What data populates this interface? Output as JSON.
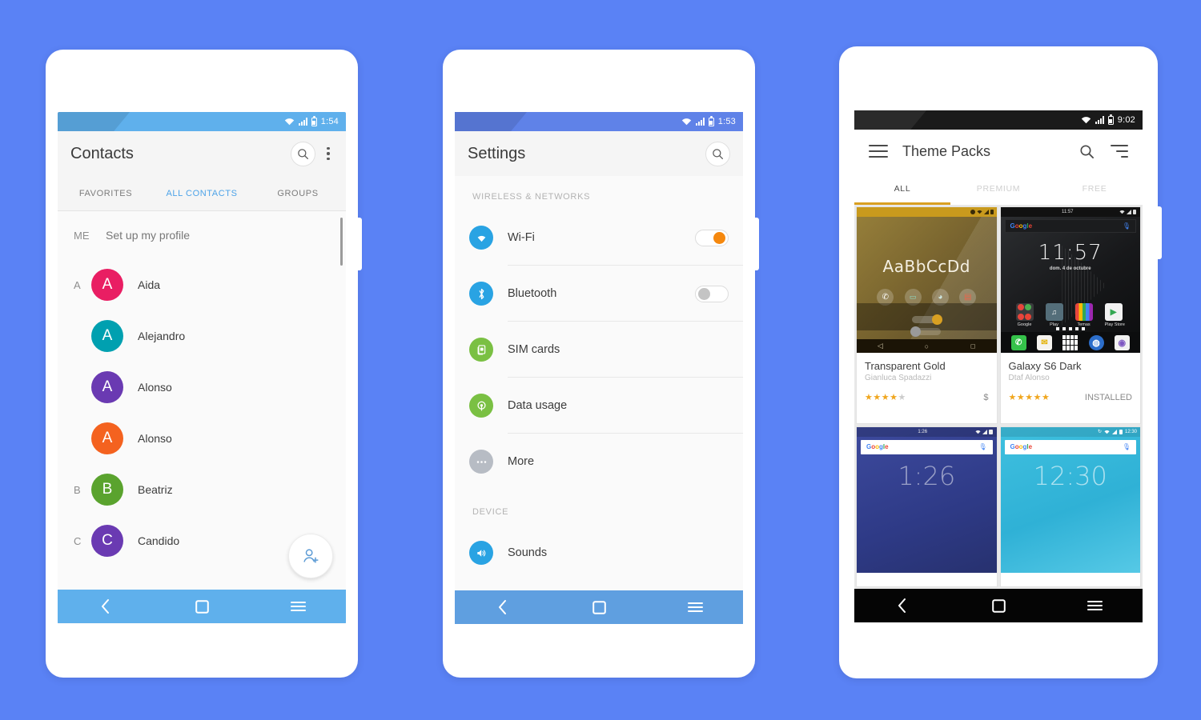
{
  "background_color": "#5a82f5",
  "phone1": {
    "name": "contacts-app",
    "statusbar": {
      "time": "1:54",
      "icons": [
        "wifi-icon",
        "signal-icon",
        "battery-icon"
      ],
      "bg": "#5fb0ec"
    },
    "appbar": {
      "title": "Contacts",
      "search_icon": "search-icon",
      "overflow_icon": "kebab-menu-icon"
    },
    "tabs": [
      {
        "label": "FAVORITES",
        "active": false
      },
      {
        "label": "ALL CONTACTS",
        "active": true
      },
      {
        "label": "GROUPS",
        "active": false
      }
    ],
    "list": [
      {
        "section": "ME",
        "name": "Set up my profile",
        "avatar": null,
        "color": null,
        "is_me": true
      },
      {
        "section": "A",
        "name": "Aida",
        "avatar": "A",
        "color": "#e91e63"
      },
      {
        "section": "",
        "name": "Alejandro",
        "avatar": "A",
        "color": "#00a0b0"
      },
      {
        "section": "",
        "name": "Alonso",
        "avatar": "A",
        "color": "#6a3ab2"
      },
      {
        "section": "",
        "name": "Alonso",
        "avatar": "A",
        "color": "#f4621f"
      },
      {
        "section": "B",
        "name": "Beatriz",
        "avatar": "B",
        "color": "#5aa32e"
      },
      {
        "section": "C",
        "name": "Candido",
        "avatar": "C",
        "color": "#6a3ab2"
      }
    ],
    "fab": {
      "icon": "add-person-icon",
      "color": "#5b9bd5"
    },
    "navbar": {
      "bg": "#5fb0ec",
      "buttons": [
        "back-icon",
        "home-icon",
        "recents-icon"
      ]
    }
  },
  "phone2": {
    "name": "settings-app",
    "statusbar": {
      "time": "1:53",
      "icons": [
        "wifi-icon",
        "signal-icon",
        "battery-icon"
      ],
      "bg": "#5f82e8"
    },
    "appbar": {
      "title": "Settings",
      "search_icon": "search-icon"
    },
    "sections": [
      {
        "header": "WIRELESS & NETWORKS",
        "rows": [
          {
            "label": "Wi-Fi",
            "icon": "wifi-icon",
            "icon_color": "#29a3e3",
            "toggle": "on",
            "divider": true
          },
          {
            "label": "Bluetooth",
            "icon": "bluetooth-icon",
            "icon_color": "#29a3e3",
            "toggle": "off",
            "divider": true
          },
          {
            "label": "SIM cards",
            "icon": "sim-card-icon",
            "icon_color": "#7ac043",
            "toggle": null,
            "divider": true
          },
          {
            "label": "Data usage",
            "icon": "data-usage-icon",
            "icon_color": "#7ac043",
            "toggle": null,
            "divider": true
          },
          {
            "label": "More",
            "icon": "more-icon",
            "icon_color": "#b7bcc4",
            "toggle": null,
            "divider": false
          }
        ]
      },
      {
        "header": "DEVICE",
        "rows": [
          {
            "label": "Sounds",
            "icon": "sound-icon",
            "icon_color": "#29a3e3",
            "toggle": null,
            "divider": false
          }
        ]
      }
    ],
    "toggle_on_color": "#f5880e",
    "navbar": {
      "bg": "#5f9fe0",
      "buttons": [
        "back-icon",
        "home-icon",
        "recents-icon"
      ]
    }
  },
  "phone3": {
    "name": "theme-packs-app",
    "statusbar": {
      "time": "9:02",
      "icons": [
        "wifi-icon",
        "signal-icon",
        "battery-icon"
      ],
      "bg": "#1a1a1a"
    },
    "appbar": {
      "menu_icon": "hamburger-menu-icon",
      "title": "Theme Packs",
      "search_icon": "search-icon",
      "sort_icon": "sort-icon"
    },
    "tabs": [
      {
        "label": "ALL",
        "active": true
      },
      {
        "label": "PREMIUM",
        "active": false
      },
      {
        "label": "FREE",
        "active": false
      }
    ],
    "tab_indicator_color": "#d9a022",
    "cards": [
      {
        "name": "Transparent Gold",
        "author": "Gianluca Spadazzi",
        "rating": 4,
        "stars": "★★★★",
        "stars_dim": "★",
        "status": "$",
        "preview": {
          "style": "gold",
          "sample_text": "AaBbCcDd",
          "statusbar_time": ""
        }
      },
      {
        "name": "Galaxy S6 Dark",
        "author": "Dtaf Alonso",
        "rating": 5,
        "stars": "★★★★★",
        "stars_dim": "",
        "status": "INSTALLED",
        "preview": {
          "style": "dark",
          "clock": "11:57",
          "date": "dom. 4 de octubre",
          "statusbar_time": "11:57",
          "search_label": "Google",
          "app_labels": [
            "Google",
            "Play",
            "Temas",
            "Play Store"
          ]
        }
      },
      {
        "name": "",
        "author": "",
        "rating": 0,
        "stars": "",
        "stars_dim": "",
        "status": "",
        "preview": {
          "style": "blue",
          "clock": "1:26",
          "statusbar_time": "1:26",
          "search_label": "Google"
        }
      },
      {
        "name": "",
        "author": "",
        "rating": 0,
        "stars": "",
        "stars_dim": "",
        "status": "",
        "preview": {
          "style": "cyan",
          "clock": "12:30",
          "statusbar_time": "12:30",
          "search_label": "Google"
        }
      }
    ],
    "navbar": {
      "bg": "#050505",
      "buttons": [
        "back-icon",
        "home-icon",
        "recents-icon"
      ]
    }
  }
}
